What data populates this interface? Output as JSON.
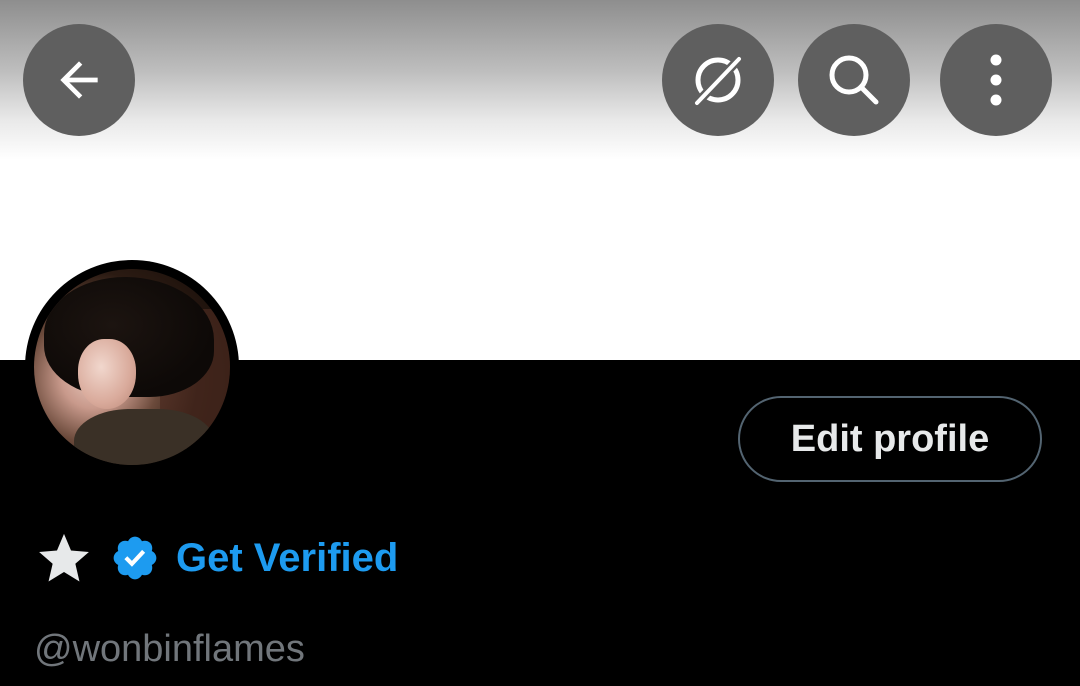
{
  "header": {
    "back_icon": "arrow-left-icon",
    "grok_icon": "grok-icon",
    "search_icon": "search-icon",
    "more_icon": "more-vertical-icon",
    "button_color": "#5f5f5f"
  },
  "profile": {
    "edit_profile_label": "Edit profile",
    "display_name_icon": "star-icon",
    "verified_icon": "verified-badge-icon",
    "get_verified_label": "Get Verified",
    "handle": "@wonbinflames"
  },
  "colors": {
    "accent": "#1d9bf0",
    "background": "#000000",
    "secondary_text": "#71767b",
    "primary_text": "#e7e9ea",
    "border": "#536471"
  }
}
